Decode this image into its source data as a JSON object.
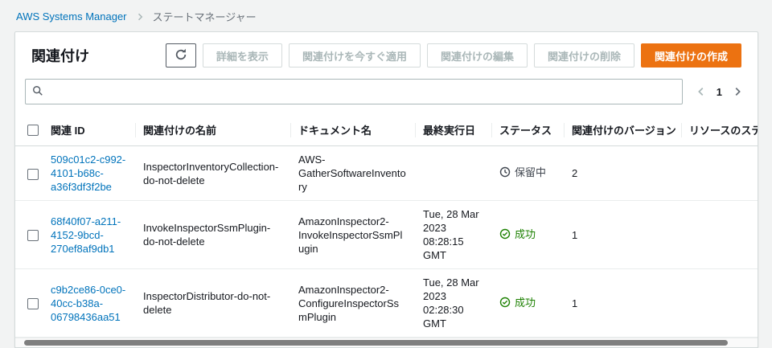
{
  "breadcrumb": {
    "items": [
      "AWS Systems Manager",
      "ステートマネージャー"
    ]
  },
  "panel": {
    "title": "関連付け"
  },
  "toolbar": {
    "refresh_icon": "refresh-circular-arrow",
    "view_details": "詳細を表示",
    "apply_now": "関連付けを今すぐ適用",
    "edit": "関連付けの編集",
    "delete": "関連付けの削除",
    "create": "関連付けの作成"
  },
  "search": {
    "placeholder": "",
    "value": "",
    "icon": "search-magnifier"
  },
  "pagination": {
    "current_page": "1"
  },
  "table": {
    "columns": [
      "関連 ID",
      "関連付けの名前",
      "ドキュメント名",
      "最終実行日",
      "ステータス",
      "関連付けのバージョン",
      "リソースのステータス"
    ],
    "rows": [
      {
        "id": "509c01c2-c992-4101-b68c-a36f3df3f2be",
        "name": "InspectorInventoryCollection-do-not-delete",
        "document": "AWS-GatherSoftwareInventory",
        "last_run": "",
        "status_label": "保留中",
        "status_type": "pending",
        "version": "2",
        "resource_status": ""
      },
      {
        "id": "68f40f07-a211-4152-9bcd-270ef8af9db1",
        "name": "InvokeInspectorSsmPlugin-do-not-delete",
        "document": "AmazonInspector2-InvokeInspectorSsmPlugin",
        "last_run": "Tue, 28 Mar 2023 08:28:15 GMT",
        "status_label": "成功",
        "status_type": "success",
        "version": "1",
        "resource_status": ""
      },
      {
        "id": "c9b2ce86-0ce0-40cc-b38a-06798436aa51",
        "name": "InspectorDistributor-do-not-delete",
        "document": "AmazonInspector2-ConfigureInspectorSsmPlugin",
        "last_run": "Tue, 28 Mar 2023 02:28:30 GMT",
        "status_label": "成功",
        "status_type": "success",
        "version": "1",
        "resource_status": ""
      }
    ]
  },
  "colors": {
    "link_blue": "#0073bb",
    "primary_orange": "#ec7211",
    "success_green": "#1d8102",
    "pending_gray": "#414750",
    "page_background": "#f2f3f3"
  }
}
